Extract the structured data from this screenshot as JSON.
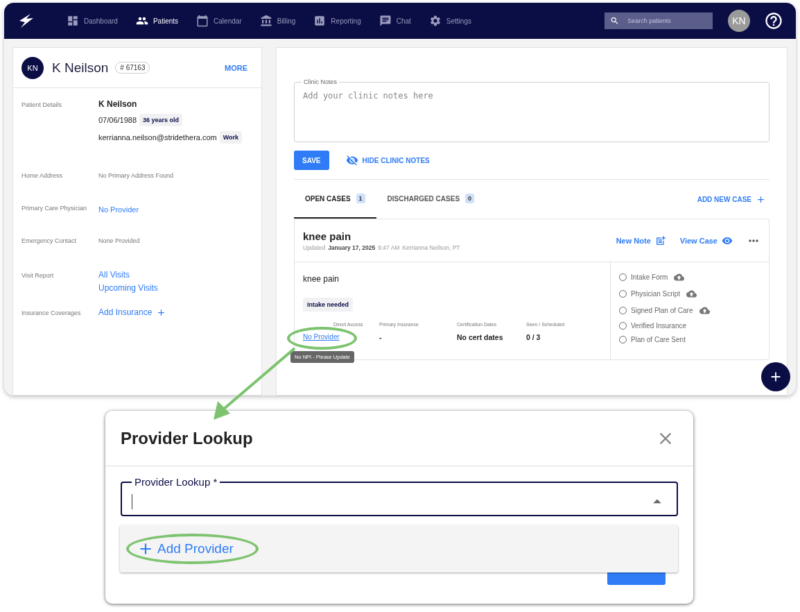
{
  "nav": {
    "items": [
      {
        "label": "Dashboard",
        "selected": false
      },
      {
        "label": "Patients",
        "selected": true
      },
      {
        "label": "Calendar",
        "selected": false
      },
      {
        "label": "Billing",
        "selected": false
      },
      {
        "label": "Reporting",
        "selected": false
      },
      {
        "label": "Chat",
        "selected": false
      },
      {
        "label": "Settings",
        "selected": false
      }
    ],
    "search": {
      "placeholder": "Search patients"
    },
    "avatar": "KN"
  },
  "patient": {
    "avatar": "KN",
    "name": "K Neilson",
    "id_badge": "# 67163",
    "more": "MORE",
    "details": [
      {
        "kind": "identity",
        "label": "Patient Details",
        "name": "K Neilson",
        "dob": "07/06/1988",
        "age": "36 years old",
        "email": "kerrianna.neilson@stridethera.com",
        "email_tag": "Work"
      },
      {
        "kind": "text",
        "label": "Home Address",
        "value": "No Primary Address Found"
      },
      {
        "kind": "link",
        "label": "Primary Care Physician",
        "value": "No Provider"
      },
      {
        "kind": "text",
        "label": "Emergency Contact",
        "value": "None Provided"
      },
      {
        "kind": "links",
        "label": "Visit Report",
        "links": [
          "All Visits",
          "Upcoming Visits"
        ]
      },
      {
        "kind": "add",
        "label": "Insurance Coverages",
        "value": "Add Insurance"
      }
    ]
  },
  "clinic_notes": {
    "label": "Clinic Notes",
    "placeholder": "Add your clinic notes here",
    "save": "SAVE",
    "hide": "HIDE CLINIC NOTES"
  },
  "case_tabs": [
    {
      "label": "OPEN CASES",
      "count": "1",
      "selected": true
    },
    {
      "label": "DISCHARGED CASES",
      "count": "0",
      "selected": false
    }
  ],
  "add_new_case": "ADD NEW CASE",
  "case": {
    "title": "knee pain",
    "updated_label": "Updated",
    "date": "January 17, 2025",
    "time": "9:47 AM",
    "author": "Kerrianna Neilson, PT",
    "new_note": "New Note",
    "view_case": "View Case",
    "description": "knee pain",
    "tag": "Intake needed",
    "fields": [
      {
        "label": "Direct Access",
        "value": "No Provider",
        "kind": "link"
      },
      {
        "label": "Primary Insurance",
        "value": "-",
        "kind": "text"
      },
      {
        "label": "Certification Dates",
        "value": "No cert dates",
        "kind": "text"
      },
      {
        "label": "Seen / Scheduled",
        "value": "0 / 3",
        "kind": "text"
      }
    ],
    "tooltip": "No NPI - Please Update",
    "checklist": [
      {
        "label": "Intake Form",
        "checked": false,
        "upload": true
      },
      {
        "label": "Physician Script",
        "checked": false,
        "upload": true
      },
      {
        "label": "Signed Plan of Care",
        "checked": false,
        "upload": true
      },
      {
        "label": "Verified Insurance",
        "checked": false,
        "upload": false
      },
      {
        "label": "Plan of Care Sent",
        "checked": false,
        "upload": false
      }
    ]
  },
  "dialog": {
    "title": "Provider Lookup",
    "field_label": "Provider Lookup *",
    "option": "Add Provider"
  }
}
